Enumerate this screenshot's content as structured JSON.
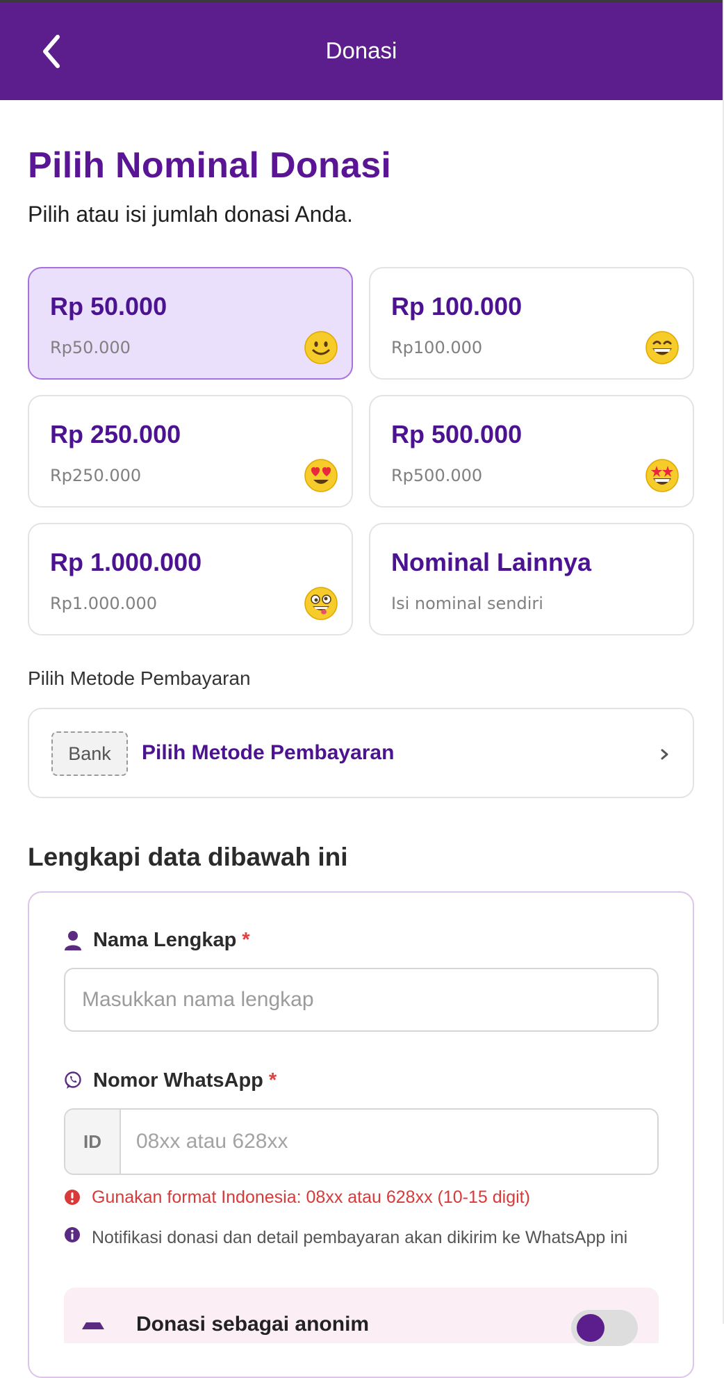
{
  "header": {
    "title": "Donasi"
  },
  "main": {
    "heading": "Pilih Nominal Donasi",
    "subtitle": "Pilih atau isi jumlah donasi Anda.",
    "options": [
      {
        "label": "Rp 50.000",
        "sub": "Rp50.000",
        "icon": "slightly-smiling-face-icon",
        "selected": true
      },
      {
        "label": "Rp 100.000",
        "sub": "Rp100.000",
        "icon": "grinning-face-icon",
        "selected": false
      },
      {
        "label": "Rp 250.000",
        "sub": "Rp250.000",
        "icon": "heart-eyes-face-icon",
        "selected": false
      },
      {
        "label": "Rp 500.000",
        "sub": "Rp500.000",
        "icon": "star-struck-face-icon",
        "selected": false
      },
      {
        "label": "Rp 1.000.000",
        "sub": "Rp1.000.000",
        "icon": "zany-face-icon",
        "selected": false
      },
      {
        "label": "Nominal Lainnya",
        "sub": "Isi nominal sendiri",
        "icon": "",
        "selected": false
      }
    ],
    "payment": {
      "label": "Pilih Metode Pembayaran",
      "badge": "Bank",
      "button_text": "Pilih Metode Pembayaran"
    }
  },
  "form": {
    "heading": "Lengkapi data dibawah ini",
    "name": {
      "label": "Nama Lengkap",
      "required": "*",
      "placeholder": "Masukkan nama lengkap",
      "value": ""
    },
    "whatsapp": {
      "label": "Nomor WhatsApp",
      "required": "*",
      "prefix": "ID",
      "placeholder": "08xx atau 628xx",
      "value": "",
      "error": "Gunakan format Indonesia: 08xx atau 628xx (10-15 digit)",
      "info": "Notifikasi donasi dan detail pembayaran akan dikirim ke WhatsApp ini"
    },
    "anonymous": {
      "label": "Donasi sebagai anonim",
      "enabled": false
    }
  },
  "colors": {
    "brand": "#5b1e8c",
    "accent_text": "#4c1391",
    "selected_bg": "#ebe0fb",
    "error": "#d83a3a"
  }
}
